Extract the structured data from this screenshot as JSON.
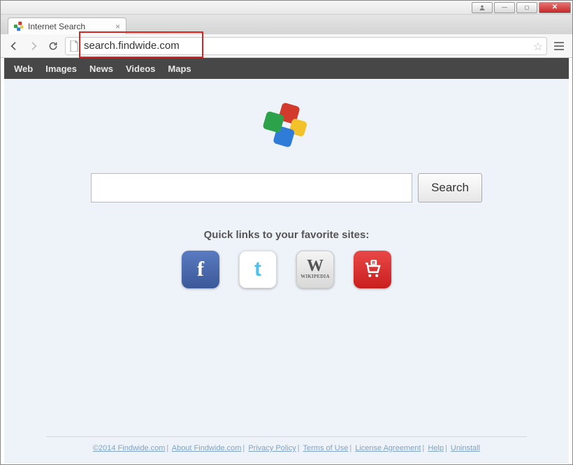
{
  "window": {
    "tab_title": "Internet Search"
  },
  "browser": {
    "url": "search.findwide.com"
  },
  "nav": {
    "items": [
      "Web",
      "Images",
      "News",
      "Videos",
      "Maps"
    ]
  },
  "search": {
    "value": "",
    "button_label": "Search"
  },
  "quicklinks": {
    "title": "Quick links to your favorite sites:",
    "items": [
      {
        "name": "facebook",
        "glyph": "f"
      },
      {
        "name": "twitter",
        "glyph": "t"
      },
      {
        "name": "wikipedia",
        "glyph": "W",
        "sub": "WIKIPEDIA"
      },
      {
        "name": "shopping-cart",
        "glyph": "R"
      }
    ]
  },
  "footer": {
    "links": [
      "©2014 Findwide.com",
      "About Findwide.com",
      "Privacy Policy",
      "Terms of Use",
      "License Agreement",
      "Help",
      "Uninstall"
    ]
  }
}
